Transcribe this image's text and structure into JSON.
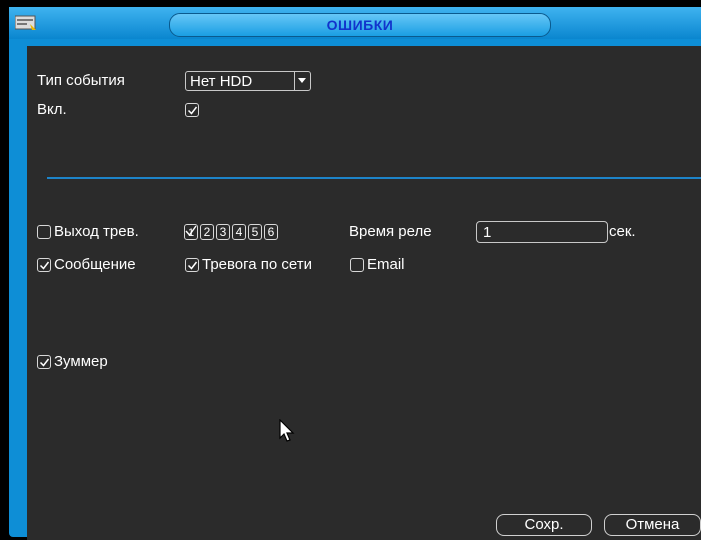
{
  "window": {
    "title": "ОШИБКИ"
  },
  "event_type": {
    "label": "Тип события",
    "value": "Нет HDD"
  },
  "enable": {
    "label": "Вкл.",
    "checked": true
  },
  "alarm_out": {
    "label": "Выход трев.",
    "checked": false,
    "channels": [
      "1",
      "2",
      "3",
      "4",
      "5",
      "6"
    ],
    "selected_channel": "1"
  },
  "relay_time": {
    "label": "Время реле",
    "value": "1",
    "unit": "сек."
  },
  "message": {
    "label": "Сообщение",
    "checked": true
  },
  "network_alarm": {
    "label": "Тревога по сети",
    "checked": true
  },
  "email": {
    "label": "Email",
    "checked": false
  },
  "buzzer": {
    "label": "Зуммер",
    "checked": true
  },
  "buttons": {
    "save": "Сохр.",
    "cancel": "Отмена"
  },
  "colors": {
    "accent": "#0e8ed6",
    "panel": "#2b2b2b",
    "title_text": "#1133cc",
    "divider": "#1d84c9"
  }
}
